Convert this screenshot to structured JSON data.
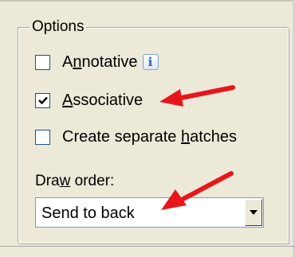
{
  "options": {
    "title": "Options",
    "annotative": {
      "label_pre": "A",
      "label_u": "n",
      "label_post": "notative",
      "checked": false,
      "info_icon": "info-icon"
    },
    "associative": {
      "label_pre": "",
      "label_u": "A",
      "label_post": "ssociative",
      "checked": true
    },
    "separate_hatches": {
      "label_pre": "Create separate ",
      "label_u": "h",
      "label_post": "atches",
      "checked": false
    }
  },
  "draw_order": {
    "label_pre": "Dra",
    "label_u": "w",
    "label_post": " order:",
    "selected": "Send to back"
  },
  "annotation_color": "#e8161b"
}
